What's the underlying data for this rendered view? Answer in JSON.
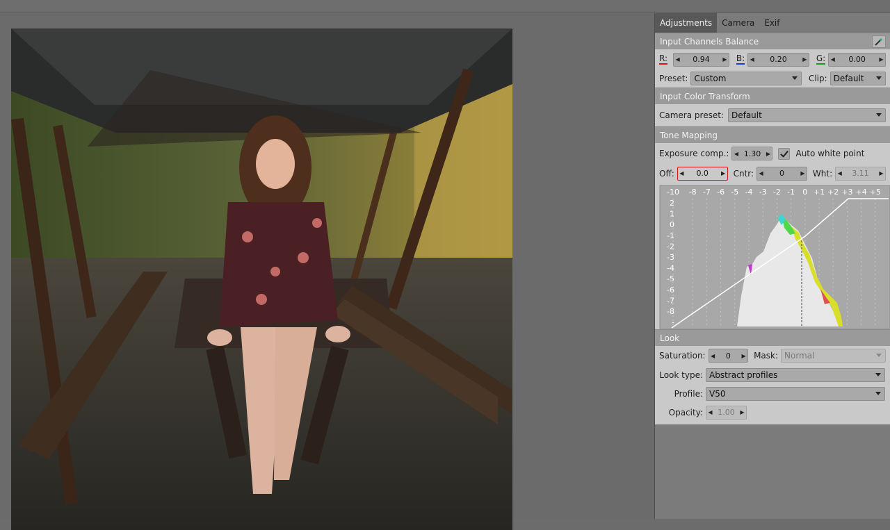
{
  "tabs": [
    "Adjustments",
    "Camera",
    "Exif"
  ],
  "icb": {
    "title": "Input Channels Balance",
    "picker_icon": "eyedropper-icon",
    "r_label": "R:",
    "r_value": "0.94",
    "b_label": "B:",
    "b_value": "0.20",
    "g_label": "G:",
    "g_value": "0.00",
    "preset_label": "Preset:",
    "preset_value": "Custom",
    "clip_label": "Clip:",
    "clip_value": "Default",
    "colors": {
      "r": "#d01818",
      "b": "#1a3ed0",
      "g": "#1a9a1a"
    }
  },
  "ict": {
    "title": "Input Color Transform",
    "camera_preset_label": "Camera preset:",
    "camera_preset_value": "Default"
  },
  "tone": {
    "title": "Tone Mapping",
    "exposure_label": "Exposure comp.:",
    "exposure_value": "1.30",
    "auto_white_label": "Auto white point",
    "auto_white_checked": true,
    "off_label": "Off:",
    "off_value": "0.0",
    "cntr_label": "Cntr:",
    "cntr_value": "0",
    "wht_label": "Wht:",
    "wht_value": "3.11",
    "x_ticks": [
      "-10",
      "-8",
      "-7",
      "-6",
      "-5",
      "-4",
      "-3",
      "-2",
      "-1",
      "0",
      "+1",
      "+2",
      "+3",
      "+4",
      "+5"
    ],
    "y_ticks": [
      "2",
      "1",
      "0",
      "-1",
      "-2",
      "-3",
      "-4",
      "-5",
      "-6",
      "-7",
      "-8",
      "-"
    ]
  },
  "look": {
    "title": "Look",
    "saturation_label": "Saturation:",
    "saturation_value": "0",
    "mask_label": "Mask:",
    "mask_value": "Normal",
    "look_type_label": "Look type:",
    "look_type_value": "Abstract profiles",
    "profile_label": "Profile:",
    "profile_value": "V50",
    "opacity_label": "Opacity:",
    "opacity_value": "1.00"
  }
}
